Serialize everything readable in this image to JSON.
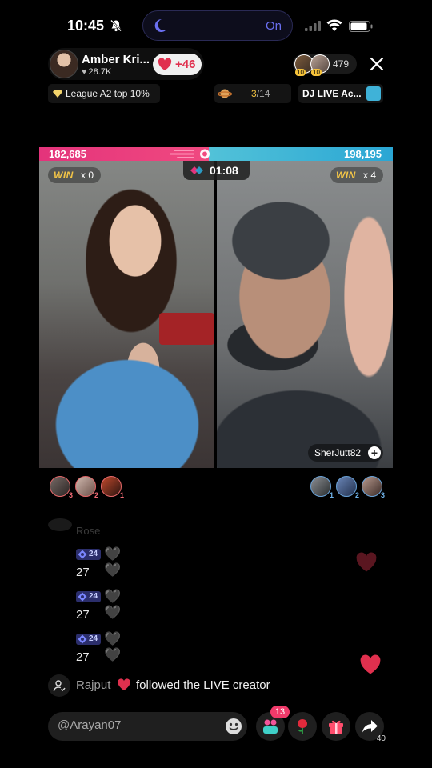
{
  "status_bar": {
    "time": "10:45",
    "focus_label": "On"
  },
  "host": {
    "name": "Amber Kri...",
    "likes": "28.7K",
    "follow_count": "+46"
  },
  "viewers": {
    "count": "479",
    "avatars": [
      {
        "level": "10"
      },
      {
        "level": "10"
      }
    ]
  },
  "chips": {
    "league": "League A2 top 10%",
    "rank_current": "3",
    "rank_total": "/14",
    "dj": "DJ LIVE Ac..."
  },
  "battle": {
    "score_left": "182,685",
    "score_right": "198,195",
    "score_left_value": 182685,
    "score_right_value": 198195,
    "timer": "01:08",
    "win_label": "WIN",
    "win_left": "x 0",
    "win_right": "x 4",
    "opponent_name": "SherJutt82",
    "left_gifters": [
      "3",
      "2",
      "1"
    ],
    "right_gifters": [
      "1",
      "2",
      "3"
    ]
  },
  "chat": {
    "faded_name": "Rose",
    "messages": [
      {
        "level": "24",
        "text": "27"
      },
      {
        "level": "24",
        "text": "27"
      },
      {
        "level": "24",
        "text": "27"
      }
    ],
    "system": {
      "user": "Rajput",
      "message": "followed the LIVE creator"
    }
  },
  "bottom": {
    "comment_placeholder": "@Arayan07",
    "gift_count": "13",
    "share_count": "40"
  },
  "colors": {
    "red_team": "#e4337b",
    "blue_team": "#2aa6d4",
    "heart": "#e0304e",
    "win_gold": "#f3c547"
  }
}
